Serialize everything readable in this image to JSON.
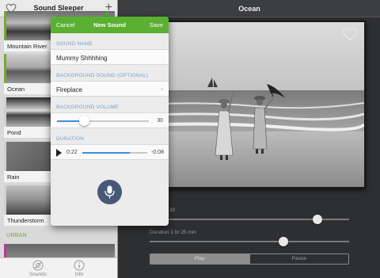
{
  "sidebar": {
    "title": "Sound Sleeper",
    "add_symbol": "+",
    "items": [
      {
        "label": "Mountain River"
      },
      {
        "label": "Ocean"
      },
      {
        "label": "Pond"
      },
      {
        "label": "Rain"
      },
      {
        "label": "Thunderstorm"
      }
    ],
    "section_urban": "URBAN",
    "tabs": [
      {
        "label": "Sounds",
        "icon": "sounds-icon"
      },
      {
        "label": "Info",
        "icon": "info-icon"
      }
    ],
    "accent_color": "#7aa82c"
  },
  "main": {
    "title": "Ocean",
    "volume_label_partial": "30",
    "volume_level": 0.84,
    "duration_label": "Duration 1 hr 25 min",
    "duration_level": 0.67,
    "play_label": "Play",
    "pause_label": "Pause"
  },
  "popover": {
    "cancel_label": "Cancel",
    "title": "New Sound",
    "save_label": "Save",
    "name_section": "SOUND NAME",
    "name_value": "Mummy Shhhhing",
    "bg_section": "BACKGROUND SOUND (OPTIONAL)",
    "bg_value": "Fireplace",
    "vol_section": "BACKGROUND VOLUME",
    "vol_value": "30",
    "vol_level": 0.3,
    "dur_section": "DURATION",
    "dur_current": "0:22",
    "dur_remaining": "-0:08",
    "dur_level": 0.73,
    "header_color": "#5ab031",
    "mic_color": "#465a78"
  }
}
